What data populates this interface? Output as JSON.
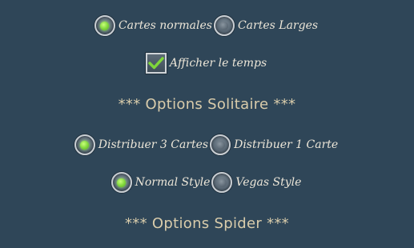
{
  "cards": {
    "normal_label": "Cartes normales",
    "large_label": "Cartes Larges",
    "selected": "normal"
  },
  "time": {
    "label": "Afficher le temps",
    "checked": true
  },
  "solitaire": {
    "title": "*** Options Solitaire ***",
    "deal3_label": "Distribuer 3 Cartes",
    "deal1_label": "Distribuer 1 Carte",
    "normal_style_label": "Normal Style",
    "vegas_style_label": "Vegas Style"
  },
  "spider": {
    "title": "*** Options Spider ***"
  },
  "colors": {
    "background": "#2f4658",
    "selected_radio": "#7fd63a",
    "checkmark": "#7fd63a",
    "section_title": "#d9ccab"
  }
}
